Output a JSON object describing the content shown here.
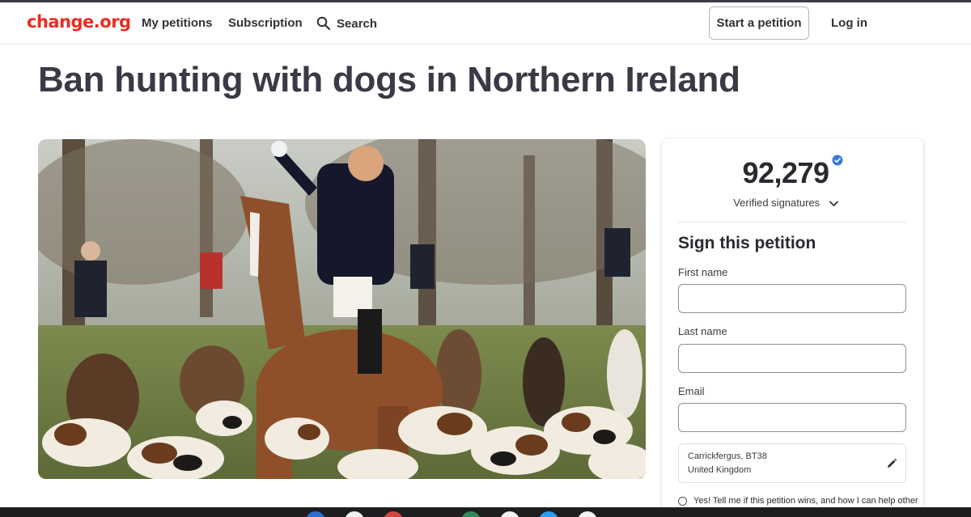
{
  "header": {
    "logo": "change.org",
    "nav": [
      "My petitions",
      "Subscription"
    ],
    "search_label": "Search",
    "start_petition": "Start a petition",
    "login": "Log in"
  },
  "petition": {
    "title": "Ban hunting with dogs in Northern Ireland",
    "image_icon": "hunt-photo"
  },
  "signatures": {
    "count": "92,279",
    "verified_label": "Verified signatures"
  },
  "form": {
    "heading": "Sign this petition",
    "first_name_label": "First name",
    "last_name_label": "Last name",
    "email_label": "Email",
    "first_name_value": "",
    "last_name_value": "",
    "email_value": "",
    "location_city": "Carrickfergus, BT38",
    "location_country": "United Kingdom",
    "optin_label": "Yes! Tell me if this petition wins, and how I can help other"
  },
  "colors": {
    "brand": "#ec2c22",
    "verified": "#3a7bd5",
    "title": "#3b3946"
  },
  "icons": {
    "search": "search-icon",
    "verified": "verified-badge-icon",
    "chevron": "chevron-down-icon",
    "edit": "pencil-icon"
  }
}
